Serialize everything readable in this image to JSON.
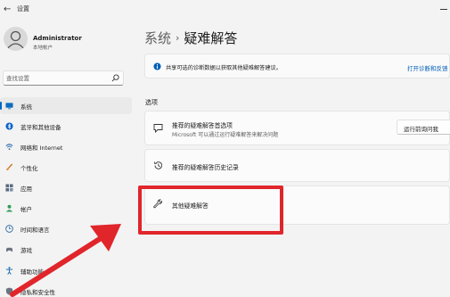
{
  "app": {
    "title": "设置"
  },
  "user": {
    "name": "Administrator",
    "role": "本地帐户"
  },
  "search": {
    "placeholder": "查找设置"
  },
  "sidebar": {
    "items": [
      {
        "label": "系统",
        "icon": "monitor-icon",
        "selected": true
      },
      {
        "label": "蓝牙和其他设备",
        "icon": "bluetooth-icon"
      },
      {
        "label": "网络和 Internet",
        "icon": "wifi-icon"
      },
      {
        "label": "个性化",
        "icon": "brush-icon"
      },
      {
        "label": "应用",
        "icon": "apps-icon"
      },
      {
        "label": "帐户",
        "icon": "person-icon"
      },
      {
        "label": "时间和语言",
        "icon": "globe-clock-icon"
      },
      {
        "label": "游戏",
        "icon": "controller-icon"
      },
      {
        "label": "辅助功能",
        "icon": "accessibility-icon"
      },
      {
        "label": "隐私和安全性",
        "icon": "shield-icon"
      }
    ]
  },
  "header": {
    "crumb": "系统",
    "separator": "›",
    "title": "疑难解答"
  },
  "info_bar": {
    "text": "共享可选的诊断数据以获取其他疑难解答建议。",
    "link": "打开诊断和反馈"
  },
  "section": {
    "label": "选项"
  },
  "cards": {
    "recommended": {
      "title": "推荐的疑难解答首选项",
      "subtitle": "Microsoft 可以通过运行疑难解答来解决问题",
      "dropdown_value": "运行前询问我"
    },
    "history": {
      "title": "推荐的疑难解答历史记录"
    },
    "other": {
      "title": "其他疑难解答"
    }
  },
  "colors": {
    "accent": "#0067c0",
    "link": "#005fb8",
    "annotation": "#e0252b"
  }
}
